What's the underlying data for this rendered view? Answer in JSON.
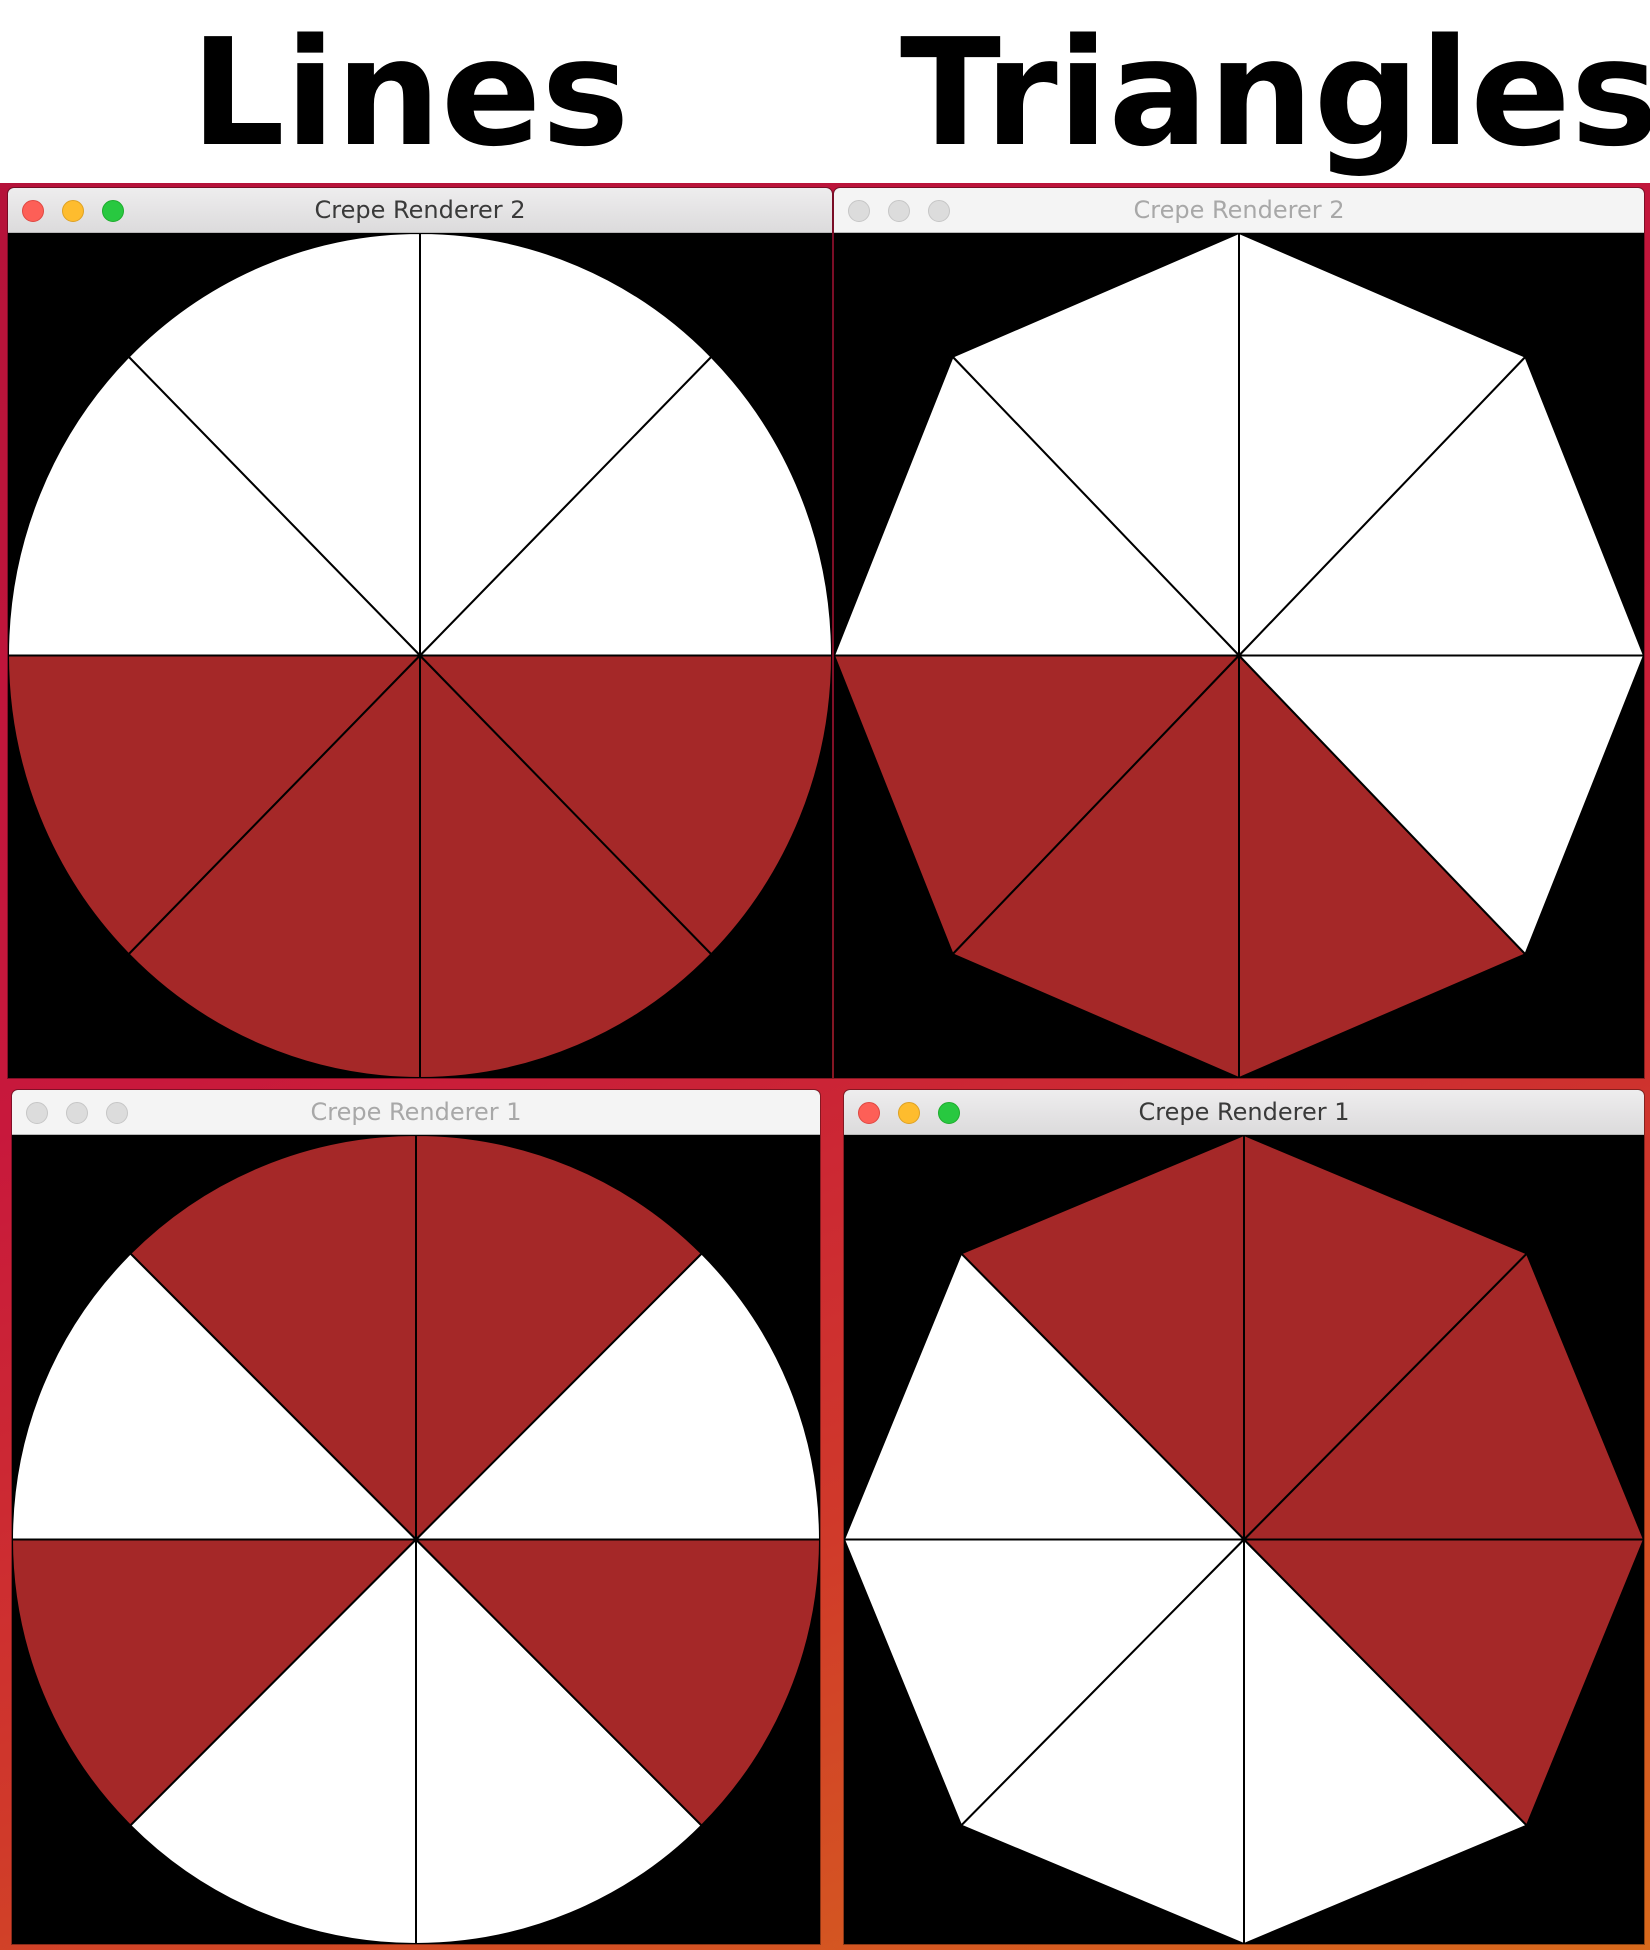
{
  "headings": {
    "left": "Lines",
    "right": "Triangles"
  },
  "colors": {
    "red": "#a52828",
    "white": "#ffffff",
    "stroke": "#000000",
    "background": "#000000"
  },
  "windows": [
    {
      "id": "lines-top",
      "title": "Crepe Renderer 2",
      "active": true,
      "mode": "lines",
      "slices": [
        "white",
        "white",
        "white",
        "white",
        "red",
        "red",
        "red",
        "red"
      ],
      "shape": "circle"
    },
    {
      "id": "triangles-top",
      "title": "Crepe Renderer 2",
      "active": false,
      "mode": "triangles",
      "slices": [
        "white",
        "white",
        "white",
        "white",
        "red",
        "red",
        "red",
        "white"
      ],
      "shape": "octagon"
    },
    {
      "id": "lines-bottom",
      "title": "Crepe Renderer 1",
      "active": false,
      "mode": "lines",
      "slices": [
        "white",
        "red",
        "red",
        "white",
        "red",
        "white",
        "white",
        "red"
      ],
      "shape": "circle"
    },
    {
      "id": "triangles-bottom",
      "title": "Crepe Renderer 1",
      "active": true,
      "mode": "triangles",
      "slices": [
        "red",
        "red",
        "red",
        "white",
        "white",
        "white",
        "white",
        "red"
      ],
      "shape": "octagon"
    }
  ]
}
